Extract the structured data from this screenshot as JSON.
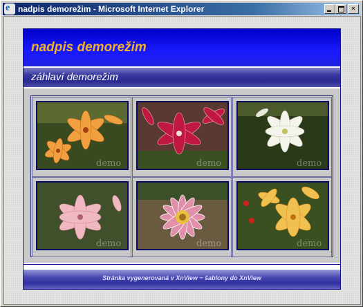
{
  "window": {
    "title": "nadpis demorežim - Microsoft Internet Explorer",
    "buttons": {
      "minimize": "_",
      "maximize": "□",
      "close": "×"
    }
  },
  "page": {
    "site_title": "nadpis demorežim",
    "subtitle": "záhlaví demorežim",
    "footer": "Stránka vygenerovaná v XnView  ~  šablony do XnView",
    "watermark": "demo"
  },
  "gallery": {
    "thumbnails": [
      {
        "subject": "orange lilies",
        "colors": {
          "bg": "#3a4a20",
          "petal": "#f0a040",
          "center": "#c06010"
        }
      },
      {
        "subject": "red lilies",
        "colors": {
          "bg": "#5a3a30",
          "petal": "#c01840",
          "center": "#f0e0e0"
        }
      },
      {
        "subject": "white lily",
        "colors": {
          "bg": "#2a3a18",
          "petal": "#f4f4ec",
          "center": "#c0c060"
        }
      },
      {
        "subject": "pink lily",
        "colors": {
          "bg": "#40502a",
          "petal": "#f0b8c0",
          "center": "#d08090"
        }
      },
      {
        "subject": "pink gazania",
        "colors": {
          "bg": "#6a5a40",
          "petal": "#e090a8",
          "center": "#e8c040"
        }
      },
      {
        "subject": "yellow lilies",
        "colors": {
          "bg": "#3a5020",
          "petal": "#f0c050",
          "center": "#e09020"
        }
      }
    ]
  },
  "colors": {
    "header": "#1a1aff",
    "title_accent": "#f0b030",
    "titlebar": "#0a246a"
  }
}
